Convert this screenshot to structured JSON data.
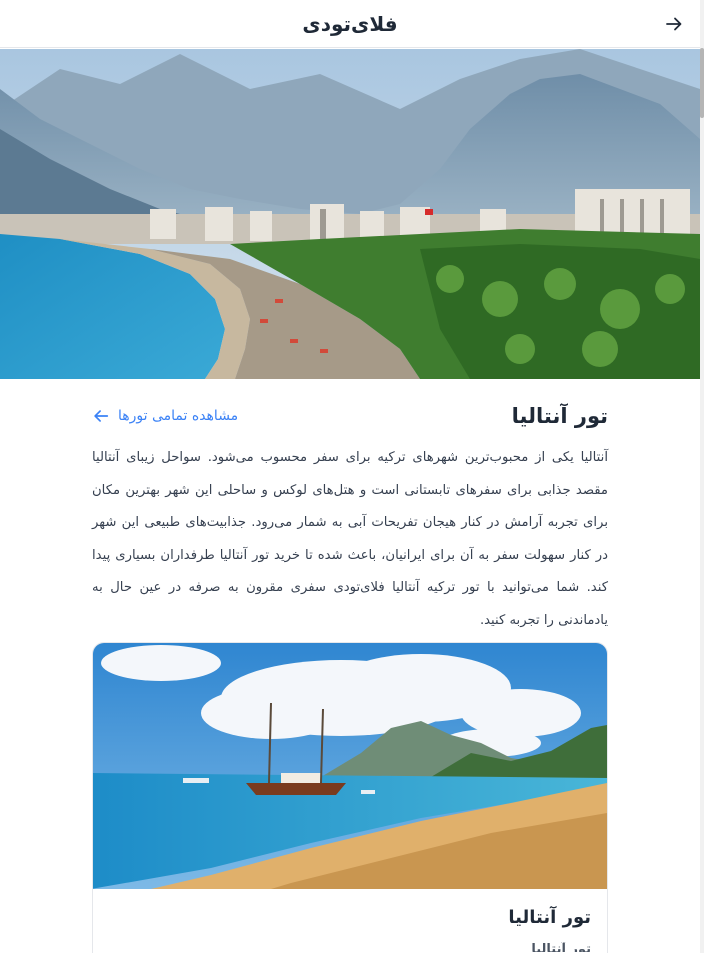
{
  "header": {
    "brand": "فلای‌تودی",
    "back_icon": "arrow-right-icon"
  },
  "hero": {
    "image": "antalya-coast-photo"
  },
  "main": {
    "title": "تور آنتالیا",
    "all_tours_link": "مشاهده تمامی تورها",
    "link_icon": "arrow-left-icon",
    "description": "آنتالیا یکی از محبوب‌ترین شهرهای ترکیه برای سفر محسوب می‌شود. سواحل زیبای آنتالیا مقصد جذابی برای سفرهای تابستانی است و هتل‌های لوکس و ساحلی این شهر بهترین مکان برای تجربه آرامش در کنار هیجان تفریحات آبی به شمار می‌رود. جذابیت‌های طبیعی این شهر در کنار سهولت سفر به آن برای ایرانیان، باعث شده تا خرید تور آنتالیا طرفداران بسیاری پیدا کند. شما می‌توانید با تور ترکیه آنتالیا فلای‌تودی سفری مقرون به صرفه در عین حال به یادماندنی را تجربه کنید."
  },
  "card": {
    "image": "antalya-beach-boat-photo",
    "title": "تور آنتالیا",
    "subtitle": "تور آنتالیا"
  },
  "colors": {
    "accent": "#3b82f6",
    "text": "#1f2937"
  }
}
